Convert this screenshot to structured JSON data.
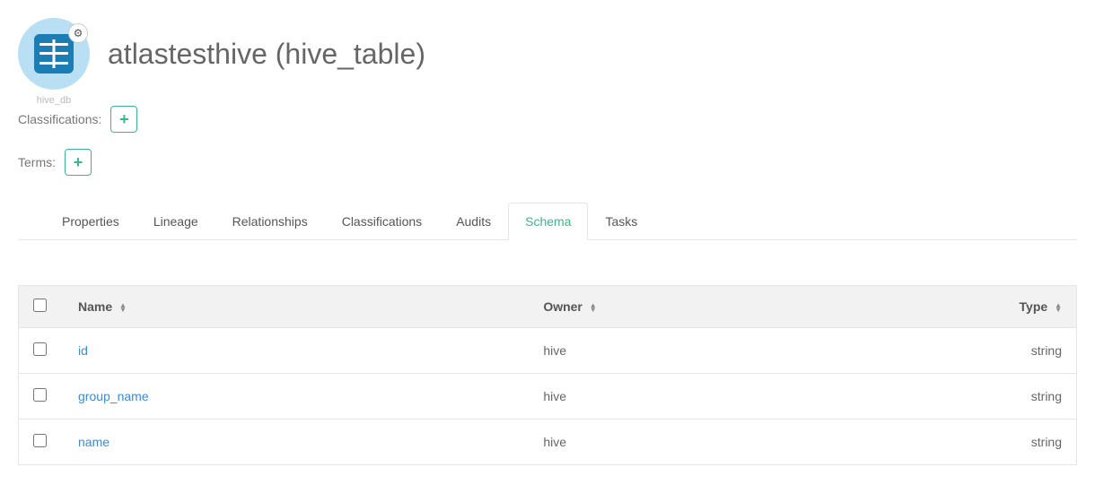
{
  "entity": {
    "title": "atlastesthive (hive_table)",
    "subtype_hint": "hive_db"
  },
  "meta": {
    "classifications_label": "Classifications:",
    "terms_label": "Terms:"
  },
  "tabs": [
    {
      "label": "Properties",
      "active": false
    },
    {
      "label": "Lineage",
      "active": false
    },
    {
      "label": "Relationships",
      "active": false
    },
    {
      "label": "Classifications",
      "active": false
    },
    {
      "label": "Audits",
      "active": false
    },
    {
      "label": "Schema",
      "active": true
    },
    {
      "label": "Tasks",
      "active": false
    }
  ],
  "table": {
    "headers": {
      "name": "Name",
      "owner": "Owner",
      "type": "Type"
    },
    "rows": [
      {
        "name": "id",
        "owner": "hive",
        "type": "string"
      },
      {
        "name": "group_name",
        "owner": "hive",
        "type": "string"
      },
      {
        "name": "name",
        "owner": "hive",
        "type": "string"
      }
    ]
  }
}
